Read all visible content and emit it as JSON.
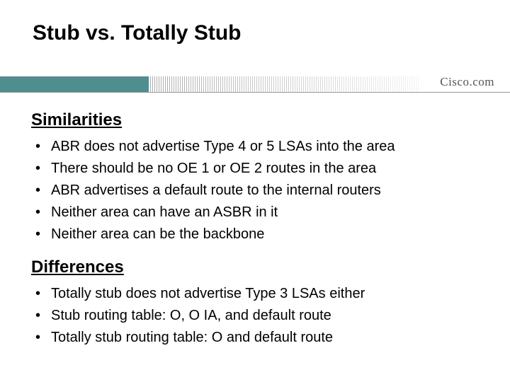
{
  "title": "Stub vs. Totally Stub",
  "logo": "Cisco.com",
  "similarities": {
    "heading": "Similarities",
    "items": [
      "ABR does not advertise Type 4 or 5 LSAs into the area",
      "There should be no OE 1 or OE 2 routes in the area",
      "ABR advertises a default route to the internal routers",
      "Neither area can have an ASBR in it",
      "Neither area can be the backbone"
    ]
  },
  "differences": {
    "heading": "Differences",
    "items": [
      "Totally stub does not advertise Type 3 LSAs either",
      "Stub routing table: O, O IA, and default route",
      "Totally stub routing table: O and default route"
    ]
  }
}
